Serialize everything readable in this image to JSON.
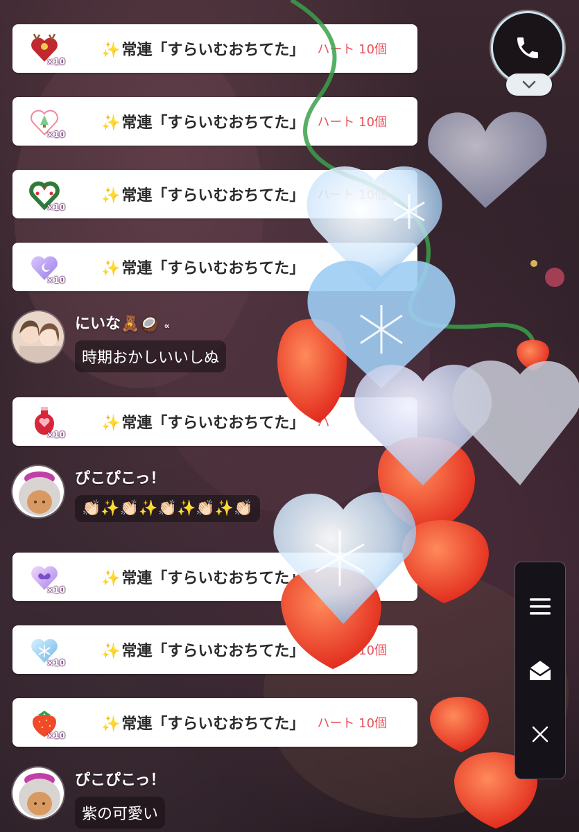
{
  "gift_rows": [
    {
      "icon": "reindeer-heart-icon",
      "count": "×10",
      "sparkle": "✨",
      "text": "常連「すらいむおちてた」",
      "amount": "ハート 10個"
    },
    {
      "icon": "christmas-tree-heart-icon",
      "count": "×10",
      "sparkle": "✨",
      "text": "常連「すらいむおちてた」",
      "amount": "ハート 10個"
    },
    {
      "icon": "wreath-heart-icon",
      "count": "×10",
      "sparkle": "✨",
      "text": "常連「すらいむおちてた」",
      "amount": "ハート 10個"
    },
    {
      "icon": "moon-heart-icon",
      "count": "×10",
      "sparkle": "✨",
      "text": "常連「すらいむおちてた」",
      "amount": ""
    },
    {
      "icon": "potion-heart-icon",
      "count": "×10",
      "sparkle": "✨",
      "text": "常連「すらいむおちてた」",
      "amount": "ハ"
    },
    {
      "icon": "butterfly-heart-icon",
      "count": "×10",
      "sparkle": "✨",
      "text": "常連「すらいむおちてた」",
      "amount": ""
    },
    {
      "icon": "snowflake-heart-icon",
      "count": "×10",
      "sparkle": "✨",
      "text": "常連「すらいむおちてた」",
      "amount": "ハート 10個"
    },
    {
      "icon": "strawberry-icon",
      "count": "×10",
      "sparkle": "✨",
      "text": "常連「すらいむおちてた」",
      "amount": "ハート 10個"
    }
  ],
  "comments": [
    {
      "name": "にいな🧸🥥",
      "suffix": "∝",
      "message": "時期おかしいいしぬ"
    },
    {
      "name": "ぴこぴこっ！",
      "message": "👏🏻✨👏🏻✨👏🏻✨👏🏻✨👏🏻"
    },
    {
      "name": "ぴこぴこっ！",
      "message": "紫の可愛い"
    }
  ],
  "icons": {
    "call": "phone-icon",
    "collapse": "chevron-down-icon",
    "menu": "menu-icon",
    "mail": "mail-icon",
    "close": "close-icon"
  },
  "colors": {
    "amount": "#e8505b",
    "bubble": "#140e12",
    "panel": "#15121a"
  }
}
